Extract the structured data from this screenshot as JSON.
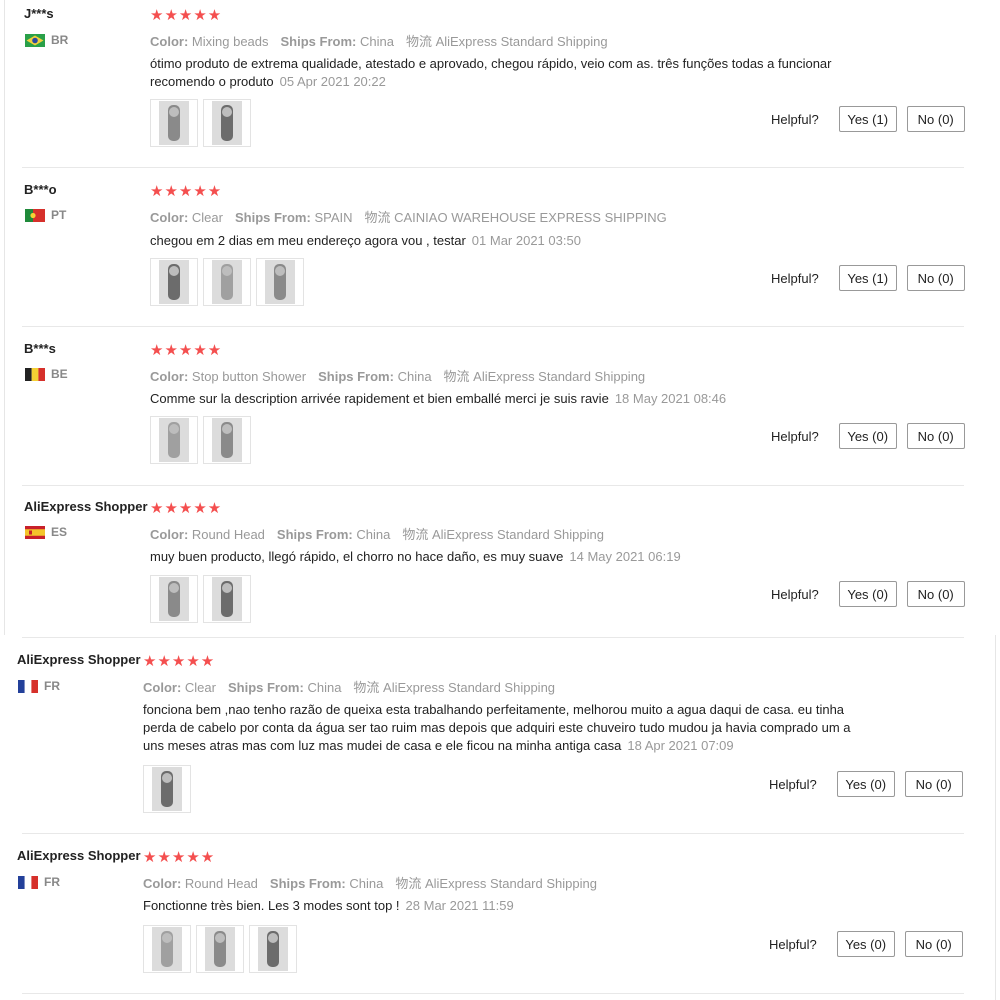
{
  "labels": {
    "color": "Color:",
    "ships_from": "Ships From:",
    "helpful": "Helpful?",
    "stars": "★★★★★"
  },
  "reviews": [
    {
      "user": "J***s",
      "country": "BR",
      "color_value": "Mixing beads",
      "ships_from_value": "China",
      "shipping": "物流 AliExpress Standard Shipping",
      "text": "ótimo produto de extrema qualidade, atestado e aprovado, chegou rápido, veio com as. três funções todas a funcionar recomendo o produto",
      "date": "05 Apr 2021 20:22",
      "yes": "Yes (1)",
      "no": "No (0)",
      "photos": 2
    },
    {
      "user": "B***o",
      "country": "PT",
      "color_value": "Clear",
      "ships_from_value": "SPAIN",
      "shipping": "物流 CAINIAO WAREHOUSE EXPRESS SHIPPING",
      "text": "chegou em 2 dias em meu endereço agora vou , testar",
      "date": "01 Mar 2021 03:50",
      "yes": "Yes (1)",
      "no": "No (0)",
      "photos": 3
    },
    {
      "user": "B***s",
      "country": "BE",
      "color_value": "Stop button Shower",
      "ships_from_value": "China",
      "shipping": "物流 AliExpress Standard Shipping",
      "text": "Comme sur la description arrivée rapidement et bien emballé merci je suis ravie",
      "date": "18 May 2021 08:46",
      "yes": "Yes (0)",
      "no": "No (0)",
      "photos": 2
    },
    {
      "user": "AliExpress Shopper",
      "country": "ES",
      "color_value": "Round Head",
      "ships_from_value": "China",
      "shipping": "物流 AliExpress Standard Shipping",
      "text": "muy buen producto, llegó rápido, el chorro no hace daño, es muy suave",
      "date": "14 May 2021 06:19",
      "yes": "Yes (0)",
      "no": "No (0)",
      "photos": 2
    },
    {
      "user": "AliExpress Shopper",
      "country": "FR",
      "color_value": "Clear",
      "ships_from_value": "China",
      "shipping": "物流 AliExpress Standard Shipping",
      "text": "fonciona bem ,nao tenho razão de queixa esta trabalhando perfeitamente, melhorou muito a agua daqui de casa. eu tinha perda de cabelo por conta da água ser tao ruim mas depois que adquiri este chuveiro tudo mudou ja havia comprado um a uns meses atras mas com luz mas mudei de casa e ele ficou na minha antiga casa",
      "date": "18 Apr 2021 07:09",
      "yes": "Yes (0)",
      "no": "No (0)",
      "photos": 1
    },
    {
      "user": "AliExpress Shopper",
      "country": "FR",
      "color_value": "Round Head",
      "ships_from_value": "China",
      "shipping": "物流 AliExpress Standard Shipping",
      "text": "Fonctionne très bien. Les 3 modes sont top !",
      "date": "28 Mar 2021 11:59",
      "yes": "Yes (0)",
      "no": "No (0)",
      "photos": 3
    }
  ],
  "flag_colors": {
    "BR": [
      "#2aa049",
      "#f2d03c",
      "#2b4aa0"
    ],
    "PT": [
      "#1f8a3a",
      "#d6302b"
    ],
    "BE": [
      "#222222",
      "#f4d034",
      "#d6302b"
    ],
    "ES": [
      "#c8202b",
      "#f4c52b"
    ],
    "FR": [
      "#23409a",
      "#ffffff",
      "#d6302b"
    ]
  }
}
